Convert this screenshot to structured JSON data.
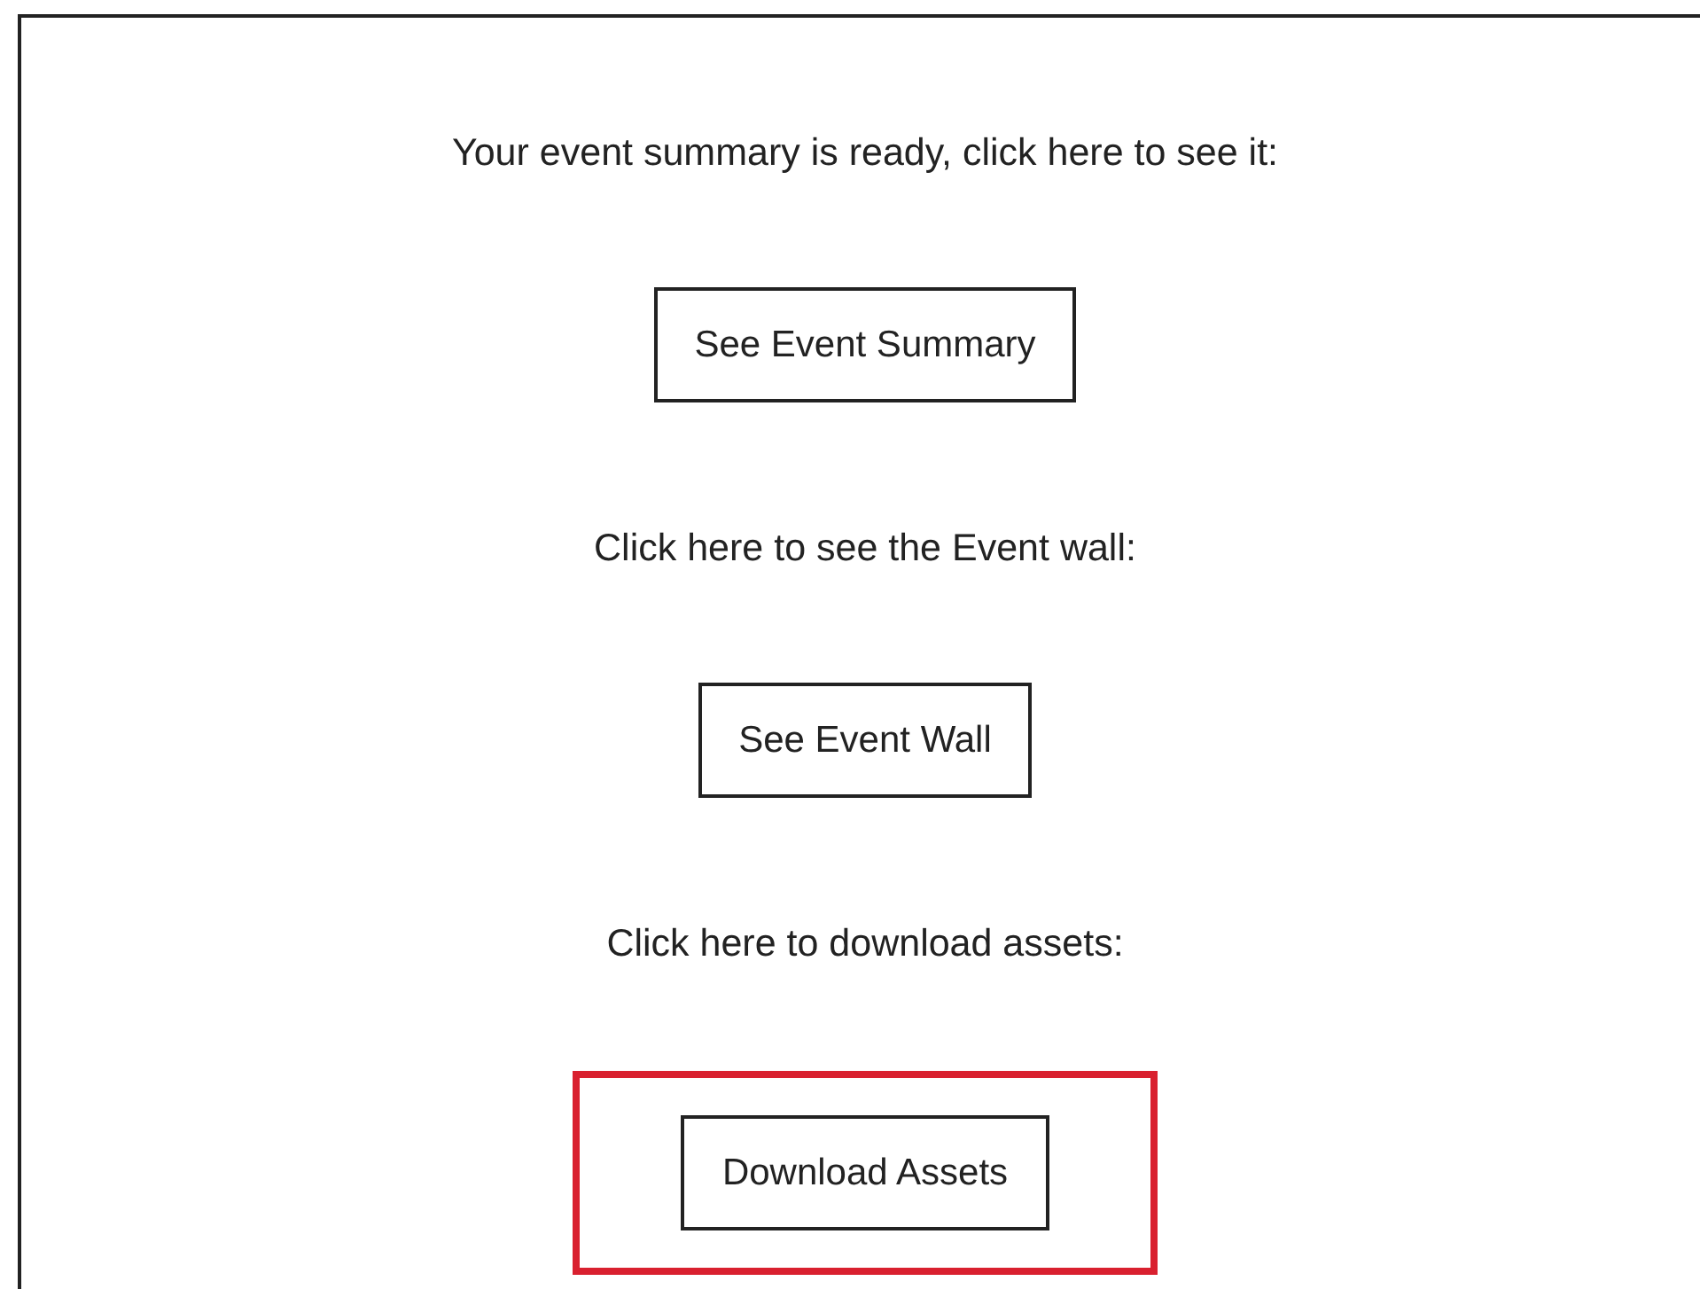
{
  "sections": [
    {
      "prompt": "Your event summary is ready, click here to see it:",
      "button": {
        "label": "See Event Summary"
      },
      "highlighted": false
    },
    {
      "prompt": "Click here to see the Event wall:",
      "button": {
        "label": "See Event Wall"
      },
      "highlighted": false
    },
    {
      "prompt": "Click here to download assets:",
      "button": {
        "label": "Download Assets"
      },
      "highlighted": true
    }
  ]
}
